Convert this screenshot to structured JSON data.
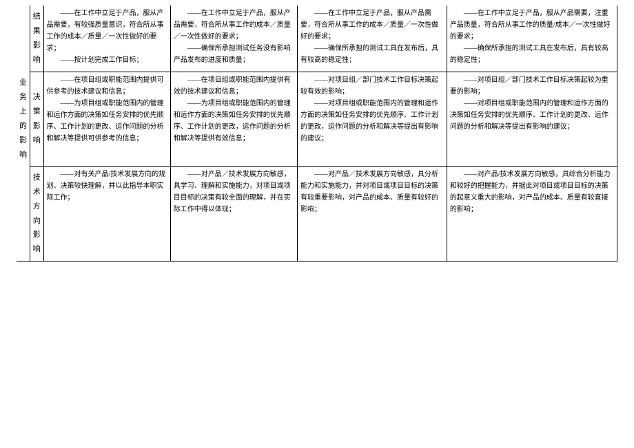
{
  "outerHeader": "业务上的影响",
  "rows": [
    {
      "header": "结果影响",
      "cells": [
        "——在工作中立足于产品，服从产品需要，有较强质量意识，符合所从事工作的成本／质量／一次性做好的要求；\n——按计划完成工作目标；",
        "——在工作中立足于产品，服从产品需要，符合所从事工作的成本／质量／一次性做好的要求；\n——确保所承担测试任务没有影响产品发布的进度和质量；",
        "——在工作中立足于产品，服从产品需要，符合所从事工作的成本／质量／一次性做好的要求；\n——确保所承担的测试工具在发布后，具有较高的稳定性；",
        "——在工作中立足于产品，服从产品需要，注重产品质量，符合所从事工作的质量/成本／一次性做好的要求；\n——确保所承担的测试工具在发布后，具有较高的稳定性；"
      ]
    },
    {
      "header": "决策影响",
      "cells": [
        "——在项目组或职能范围内提供可供参考的技术建议和信息；\n——为项目组或职能范围内的管理和运作方面的决策如任务安排的优先顺序、工作计划的更改、运作问题的分析和解决等提供可供参考的信息；",
        "——在项目组或职能范围内提供有效的技术建议和信息；\n——为项目组或职能范围内的管理和运作方面的决策如任务安排的优先顺序、工作计划的更改，运作问题的分析和解决等提供有效信息；",
        "——对项目组／部门技术工作目标决策起较有效的影响；\n——对项目组或职能范围内的管理和运作方面的决策如任务安排的优先顺序、工作计划的更改，运作问题的分析和解决等提出有影响的建议；",
        "——对项目组／部门技术工作目标决策起较为重要的影响；\n——对项目组或职能范围内的管理和运作方面的决策如任务安排的优先顺序、工作计划的更改、运作问题的分析和解决等提出有影响的建议；"
      ]
    },
    {
      "header": "技术方向影响",
      "cells": [
        "——对有关产品/技术发展方向的规划、决策较快理解，并以此指导本职实际工作；",
        "——对产品／技术发展方向敏感，具学习、理解和实施能力，对项目或项目目标的决策有较全面的理解，并在实际工作中得以体现；",
        "——对产品／技术发展方向敏感，具分析能力和实施能力，并对项目或项目目标的决策有较重要影响，对产品的成本、质量有较好的影响；",
        "——对产品/技术发展方向敏感，具综合分析能力和较好的把握能力，并据此对项目或项目目标的决策的起意义重大的影响，对产品的成本、质量有较直接的影响；"
      ]
    }
  ]
}
